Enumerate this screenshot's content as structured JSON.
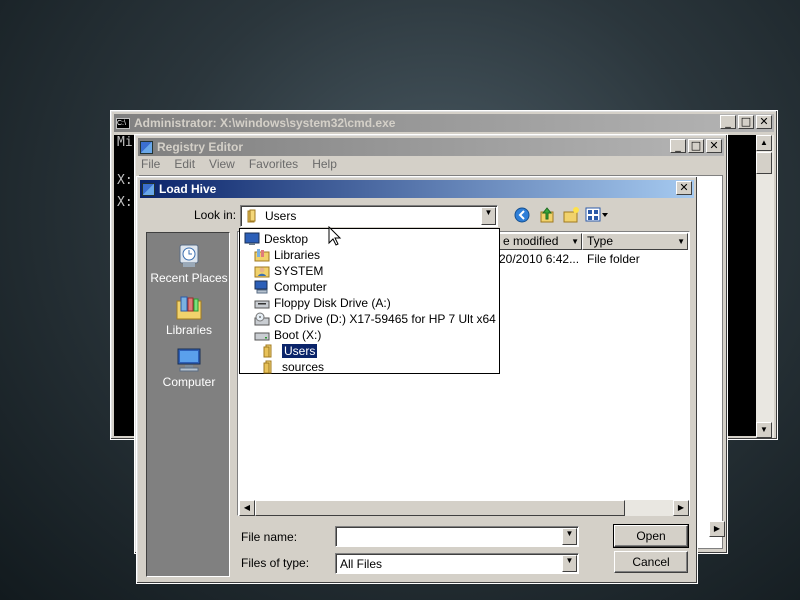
{
  "cmd": {
    "title": "Administrator: X:\\windows\\system32\\cmd.exe",
    "lines": [
      "Mi",
      "X:",
      "X:"
    ]
  },
  "regedit": {
    "title": "Registry Editor",
    "menu": [
      "File",
      "Edit",
      "View",
      "Favorites",
      "Help"
    ]
  },
  "dialog": {
    "title": "Load Hive",
    "look_in_label": "Look in:",
    "look_in_value": "Users",
    "places": [
      "Recent Places",
      "Libraries",
      "Computer"
    ],
    "columns": [
      "e modified",
      "Type"
    ],
    "rows": [
      {
        "modified": "20/2010 6:42...",
        "type": "File folder"
      }
    ],
    "tree": [
      {
        "label": "Desktop",
        "icon": "desktop-icon",
        "level": 0
      },
      {
        "label": "Libraries",
        "icon": "libraries-icon",
        "level": 1
      },
      {
        "label": "SYSTEM",
        "icon": "user-icon",
        "level": 1
      },
      {
        "label": "Computer",
        "icon": "computer-icon",
        "level": 1
      },
      {
        "label": "Floppy Disk Drive (A:)",
        "icon": "floppy-drive-icon",
        "level": 2
      },
      {
        "label": "CD Drive (D:) X17-59465 for HP 7 Ult x64",
        "icon": "cd-drive-icon",
        "level": 2
      },
      {
        "label": "Boot (X:)",
        "icon": "hard-drive-icon",
        "level": 2
      },
      {
        "label": "Users",
        "icon": "folder-icon",
        "level": 3,
        "selected": true
      },
      {
        "label": "sources",
        "icon": "folder-icon",
        "level": 3
      }
    ],
    "file_name_label": "File name:",
    "file_name_value": "",
    "files_of_type_label": "Files of type:",
    "files_of_type_value": "All Files",
    "open_label": "Open",
    "cancel_label": "Cancel"
  },
  "colors": {
    "selection": "#0a246a",
    "dialog_face": "#d4d0c8",
    "places_bar": "#808080"
  }
}
